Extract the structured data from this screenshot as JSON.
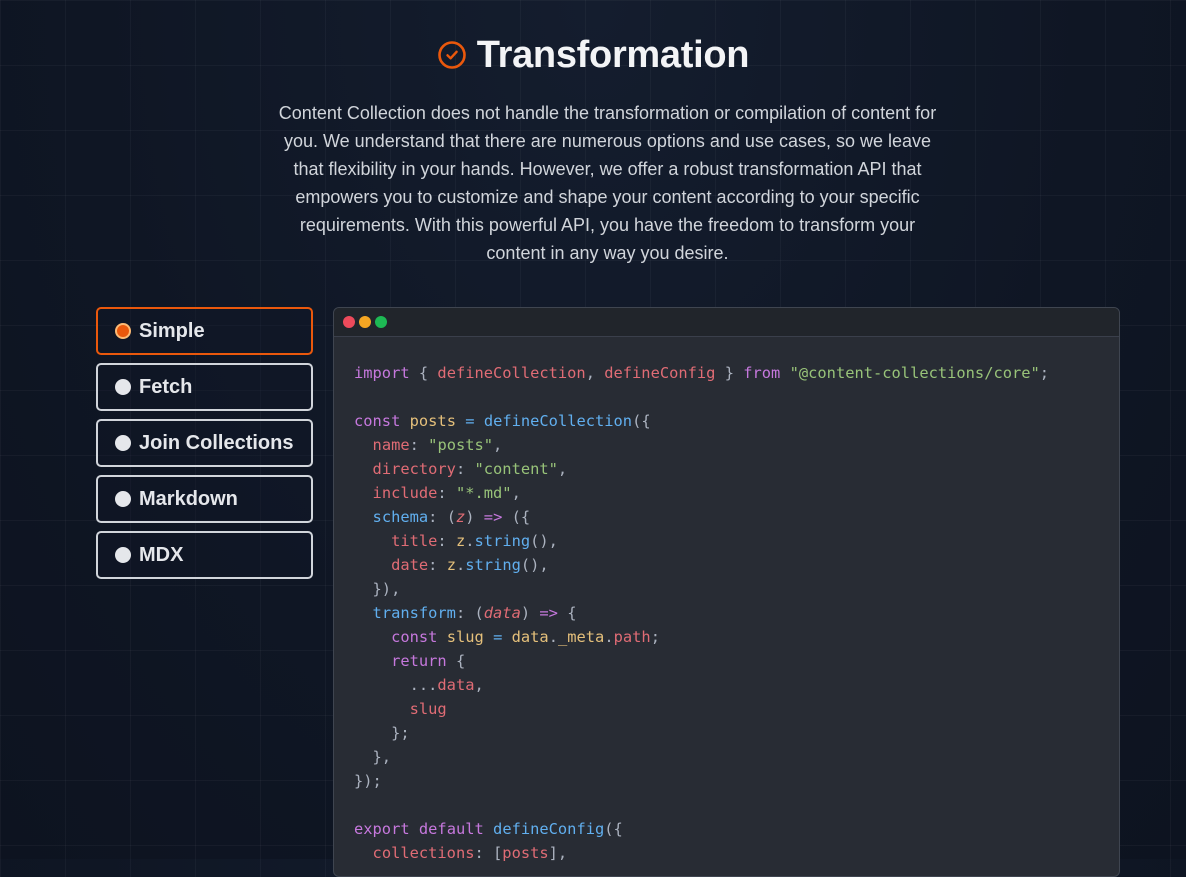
{
  "section": {
    "title": "Transformation",
    "icon": "check-circle-icon",
    "description": "Content Collection does not handle the transformation or compilation of content for you. We understand that there are numerous options and use cases, so we leave that flexibility in your hands. However, we offer a robust transformation API that empowers you to customize and shape your content according to your specific requirements. With this powerful API, you have the freedom to transform your content in any way you desire."
  },
  "tabs": [
    {
      "label": "Simple",
      "active": true
    },
    {
      "label": "Fetch",
      "active": false
    },
    {
      "label": "Join Collections",
      "active": false
    },
    {
      "label": "Markdown",
      "active": false
    },
    {
      "label": "MDX",
      "active": false
    }
  ],
  "editor": {
    "window_dots": [
      "#ed4a5b",
      "#f5a623",
      "#1db954"
    ],
    "code_lines": [
      [
        [
          "kw",
          "import"
        ],
        [
          "p",
          " { "
        ],
        [
          "vr",
          "defineCollection"
        ],
        [
          "p",
          ", "
        ],
        [
          "vr",
          "defineConfig"
        ],
        [
          "p",
          " } "
        ],
        [
          "kw",
          "from"
        ],
        [
          "p",
          " "
        ],
        [
          "st",
          "\"@content-collections/core\""
        ],
        [
          "p",
          ";"
        ]
      ],
      [],
      [
        [
          "kw",
          "const"
        ],
        [
          "p",
          " "
        ],
        [
          "yl",
          "posts"
        ],
        [
          "p",
          " "
        ],
        [
          "fn",
          "="
        ],
        [
          "p",
          " "
        ],
        [
          "fn",
          "defineCollection"
        ],
        [
          "p",
          "({"
        ]
      ],
      [
        [
          "p",
          "  "
        ],
        [
          "vr",
          "name"
        ],
        [
          "p",
          ": "
        ],
        [
          "st",
          "\"posts\""
        ],
        [
          "p",
          ","
        ]
      ],
      [
        [
          "p",
          "  "
        ],
        [
          "vr",
          "directory"
        ],
        [
          "p",
          ": "
        ],
        [
          "st",
          "\"content\""
        ],
        [
          "p",
          ","
        ]
      ],
      [
        [
          "p",
          "  "
        ],
        [
          "vr",
          "include"
        ],
        [
          "p",
          ": "
        ],
        [
          "st",
          "\"*.md\""
        ],
        [
          "p",
          ","
        ]
      ],
      [
        [
          "p",
          "  "
        ],
        [
          "fn",
          "schema"
        ],
        [
          "p",
          ": ("
        ],
        [
          "it",
          "z"
        ],
        [
          "p",
          ") "
        ],
        [
          "kw",
          "=>"
        ],
        [
          "p",
          " ({"
        ]
      ],
      [
        [
          "p",
          "    "
        ],
        [
          "vr",
          "title"
        ],
        [
          "p",
          ": "
        ],
        [
          "yl",
          "z"
        ],
        [
          "p",
          "."
        ],
        [
          "fn",
          "string"
        ],
        [
          "p",
          "(),"
        ]
      ],
      [
        [
          "p",
          "    "
        ],
        [
          "vr",
          "date"
        ],
        [
          "p",
          ": "
        ],
        [
          "yl",
          "z"
        ],
        [
          "p",
          "."
        ],
        [
          "fn",
          "string"
        ],
        [
          "p",
          "(),"
        ]
      ],
      [
        [
          "p",
          "  }),"
        ]
      ],
      [
        [
          "p",
          "  "
        ],
        [
          "fn",
          "transform"
        ],
        [
          "p",
          ": ("
        ],
        [
          "it",
          "data"
        ],
        [
          "p",
          ") "
        ],
        [
          "kw",
          "=>"
        ],
        [
          "p",
          " {"
        ]
      ],
      [
        [
          "p",
          "    "
        ],
        [
          "kw",
          "const"
        ],
        [
          "p",
          " "
        ],
        [
          "yl",
          "slug"
        ],
        [
          "p",
          " "
        ],
        [
          "fn",
          "="
        ],
        [
          "p",
          " "
        ],
        [
          "yl",
          "data"
        ],
        [
          "p",
          "."
        ],
        [
          "yl",
          "_meta"
        ],
        [
          "p",
          "."
        ],
        [
          "vr",
          "path"
        ],
        [
          "p",
          ";"
        ]
      ],
      [
        [
          "p",
          "    "
        ],
        [
          "kw",
          "return"
        ],
        [
          "p",
          " {"
        ]
      ],
      [
        [
          "p",
          "      ..."
        ],
        [
          "vr",
          "data"
        ],
        [
          "p",
          ","
        ]
      ],
      [
        [
          "p",
          "      "
        ],
        [
          "vr",
          "slug"
        ]
      ],
      [
        [
          "p",
          "    };"
        ]
      ],
      [
        [
          "p",
          "  },"
        ]
      ],
      [
        [
          "p",
          "});"
        ]
      ],
      [],
      [
        [
          "kw",
          "export"
        ],
        [
          "p",
          " "
        ],
        [
          "kw",
          "default"
        ],
        [
          "p",
          " "
        ],
        [
          "fn",
          "defineConfig"
        ],
        [
          "p",
          "({"
        ]
      ],
      [
        [
          "p",
          "  "
        ],
        [
          "vr",
          "collections"
        ],
        [
          "p",
          ": ["
        ],
        [
          "vr",
          "posts"
        ],
        [
          "p",
          "],"
        ]
      ]
    ]
  }
}
